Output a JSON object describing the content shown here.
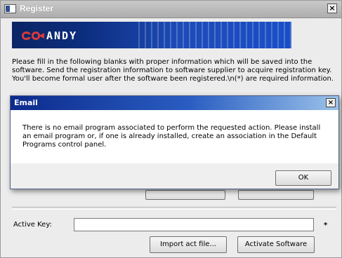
{
  "window": {
    "title": "Register",
    "close_glyph": "×",
    "icon": "app-window-icon"
  },
  "banner": {
    "brand": "ANDY",
    "logo": "brand-logo-icon",
    "colors": {
      "dark": "#0b2565",
      "light": "#1a4ec7"
    }
  },
  "intro": {
    "text": "Please fill in the following blanks with proper information which will be saved into the software. Send the registration information to software supplier to acquire registration key. You'll become formal user after the software been registered.\\n(*) are required information."
  },
  "activation": {
    "active_key_label": "Active Key:",
    "active_key_value": "",
    "required_mark": "*",
    "import_button": "Import act file...",
    "activate_button": "Activate Software"
  },
  "dialog": {
    "title": "Email",
    "close_glyph": "×",
    "message": "There is no email program associated to perform the requested action. Please install an email program or, if one is already installed, create an association in the Default Programs control panel.",
    "ok_button": "OK",
    "colors": {
      "title_start": "#0c2a8c",
      "title_end": "#9bc2ea"
    }
  }
}
